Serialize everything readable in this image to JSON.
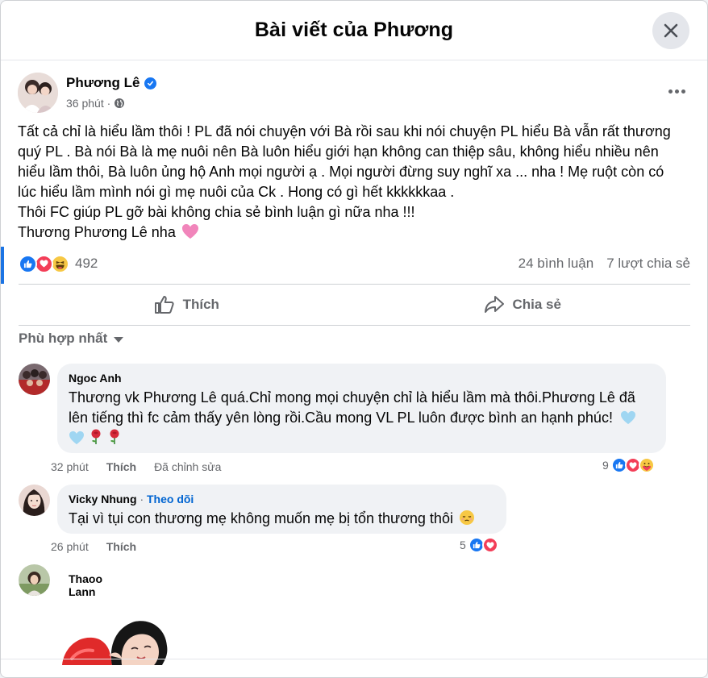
{
  "modal": {
    "title": "Bài viết của Phương"
  },
  "post": {
    "author": "Phương Lê",
    "time": "36 phút ·",
    "body_lines": [
      "Tất cả chỉ là hiểu lầm thôi ! PL đã nói chuyện với Bà rồi sau khi nói chuyện PL hiểu Bà vẫn rất thương",
      "quý PL . Bà nói Bà là mẹ nuôi nên Bà luôn hiểu giới hạn không can thiệp sâu, không hiểu nhiều nên",
      "hiểu lầm thôi, Bà luôn ủng hộ Anh mọi người ạ . Mọi người đừng suy nghĩ xa ... nha ! Mẹ ruột còn có",
      "lúc hiểu lầm mình nói gì mẹ nuôi của Ck . Hong có gì hết kkkkkkaa .",
      "Thôi FC giúp PL gỡ bài không chia sẻ bình luận gì nữa nha !!!",
      "Thương Phương Lê nha"
    ],
    "reaction_count": "492",
    "comments_count": "24 bình luận",
    "shares_count": "7 lượt chia sẻ",
    "actions": {
      "like": "Thích",
      "share": "Chia sẻ"
    }
  },
  "sort_label": "Phù hợp nhất",
  "comments": [
    {
      "name": "Ngoc Anh",
      "lines": [
        "Thương vk Phương Lê quá.Chỉ mong mọi chuyện chỉ là hiểu lầm mà thôi.Phương Lê đã",
        "lên tiếng thì fc cảm thấy yên lòng rồi.Cầu mong VL PL luôn được bình an hạnh phúc!"
      ],
      "time": "32 phút",
      "like": "Thích",
      "edited": "Đã chỉnh sửa",
      "reaction_count": "9"
    },
    {
      "name": "Vicky Nhung",
      "follow": "Theo dõi",
      "text": "Tại vì tụi con thương mẹ không muốn mẹ bị tổn thương thôi",
      "time": "26 phút",
      "like": "Thích",
      "reaction_count": "5"
    },
    {
      "name": "Thaoo Lann"
    }
  ],
  "colors": {
    "accent": "#1877f2",
    "love": "#f33e58",
    "muted": "#65676b"
  }
}
